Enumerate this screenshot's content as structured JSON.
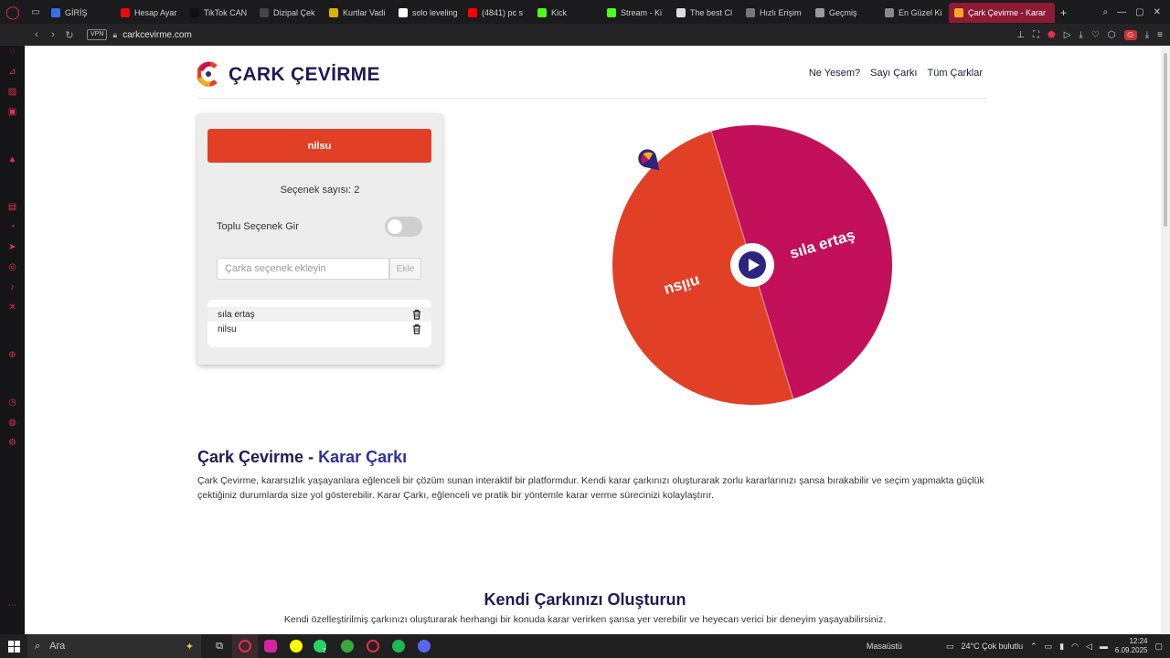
{
  "browser": {
    "tabs": [
      {
        "label": "GİRİŞ",
        "color": "#3a6ee8"
      },
      {
        "label": "Hesap Ayar",
        "color": "#e50914"
      },
      {
        "label": "TikTok CAN",
        "color": "#111111"
      },
      {
        "label": "Dizipal Çek",
        "color": "#444444"
      },
      {
        "label": "Kurtlar Vadi",
        "color": "#d7b400"
      },
      {
        "label": "solo leveling",
        "color": "#ffffff"
      },
      {
        "label": "(4841) pc s",
        "color": "#ff0000"
      },
      {
        "label": "Kick",
        "color": "#53fc18"
      },
      {
        "label": "Stream - Ki",
        "color": "#53fc18"
      },
      {
        "label": "The best Cl",
        "color": "#dddddd"
      },
      {
        "label": "Hızlı Erişim",
        "color": "#777777"
      },
      {
        "label": "Geçmiş",
        "color": "#999999"
      },
      {
        "label": "En Güzel Ki",
        "color": "#888888"
      },
      {
        "label": "Çark Çevirme - Karar",
        "color": "#f5a623"
      }
    ],
    "new_tab": "+",
    "vpn_label": "VPN",
    "url": "carkcevirme.com"
  },
  "site": {
    "brand": "ÇARK ÇEVİRME",
    "nav": [
      "Ne Yesem?",
      "Sayı Çarkı",
      "Tüm Çarklar"
    ]
  },
  "panel": {
    "result": "nilsu",
    "count_text": "Seçenek sayısı: 2",
    "bulk_label": "Toplu Seçenek Gir",
    "bulk_enabled": false,
    "input_placeholder": "Çarka seçenek ekleyin",
    "add_button": "Ekle",
    "options": [
      "sıla ertaş",
      "nilsu"
    ]
  },
  "wheel": {
    "segments": [
      {
        "label": "sıla ertaş",
        "color": "#c2105a"
      },
      {
        "label": "nilsu",
        "color": "#e24026"
      }
    ]
  },
  "content": {
    "h2_part1": "Çark Çevirme - ",
    "h2_part2": "Karar Çarkı",
    "para1": "Çark Çevirme, kararsızlık yaşayanlara eğlenceli bir çözüm sunan interaktif bir platformdur. Kendi karar çarkınızı oluşturarak zorlu kararlarınızı şansa bırakabilir ve seçim yapmakta güçlük çektiğiniz durumlarda size yol gösterebilir. Karar Çarkı, eğlenceli ve pratik bir yöntemle karar verme sürecinizi kolaylaştırır.",
    "h2b": "Kendi Çarkınızı Oluşturun",
    "para2": "Kendi özelleştirilmiş çarkınızı oluşturarak herhangi bir konuda karar verirken şansa yer verebilir ve heyecan verici bir deneyim yaşayabilirsiniz."
  },
  "taskbar": {
    "search_placeholder": "Ara",
    "desktop_label": "Masaüstü",
    "weather": "24°C  Çok bulutlu",
    "time": "12:24",
    "date": "6.09.2025",
    "notif_count": "9",
    "whatsapp_badge": "2"
  }
}
